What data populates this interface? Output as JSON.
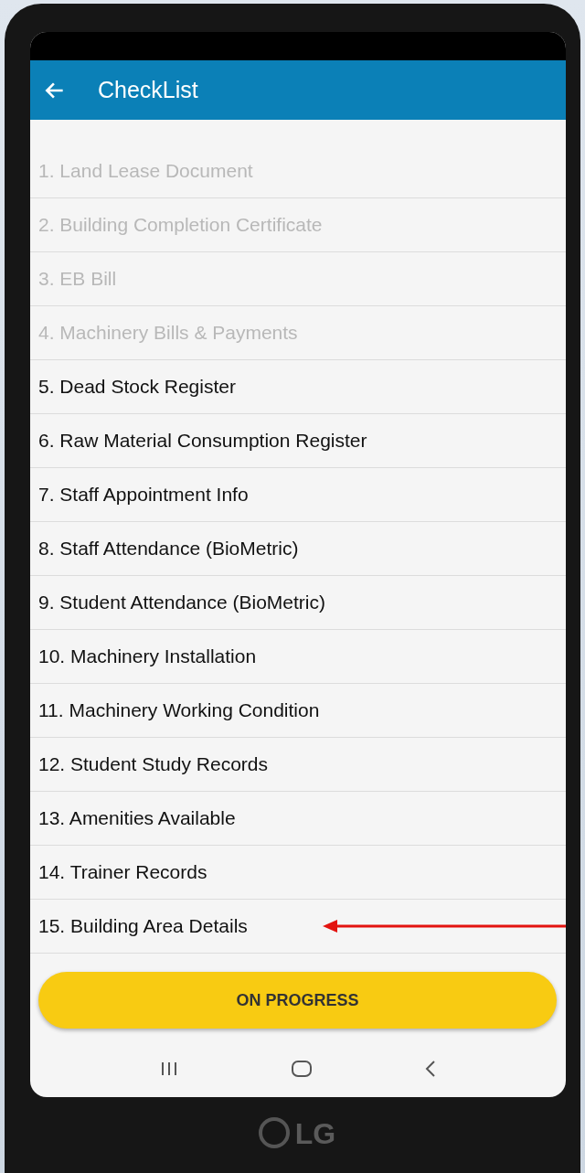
{
  "header": {
    "title": "CheckList"
  },
  "items": [
    {
      "label": "1. Land Lease Document",
      "disabled": true
    },
    {
      "label": "2. Building Completion Certificate",
      "disabled": true
    },
    {
      "label": "3. EB Bill",
      "disabled": true
    },
    {
      "label": "4. Machinery Bills & Payments",
      "disabled": true
    },
    {
      "label": "5. Dead Stock Register",
      "disabled": false
    },
    {
      "label": "6. Raw Material Consumption Register",
      "disabled": false
    },
    {
      "label": "7. Staff Appointment Info",
      "disabled": false
    },
    {
      "label": "8. Staff Attendance (BioMetric)",
      "disabled": false
    },
    {
      "label": "9. Student Attendance (BioMetric)",
      "disabled": false
    },
    {
      "label": "10. Machinery Installation",
      "disabled": false
    },
    {
      "label": "11. Machinery Working Condition",
      "disabled": false
    },
    {
      "label": "12. Student Study Records",
      "disabled": false
    },
    {
      "label": "13. Amenities Available",
      "disabled": false
    },
    {
      "label": "14. Trainer Records",
      "disabled": false
    },
    {
      "label": "15. Building Area Details",
      "disabled": false
    }
  ],
  "button": {
    "label": "ON PROGRESS"
  },
  "phone": {
    "brand": "LG"
  }
}
